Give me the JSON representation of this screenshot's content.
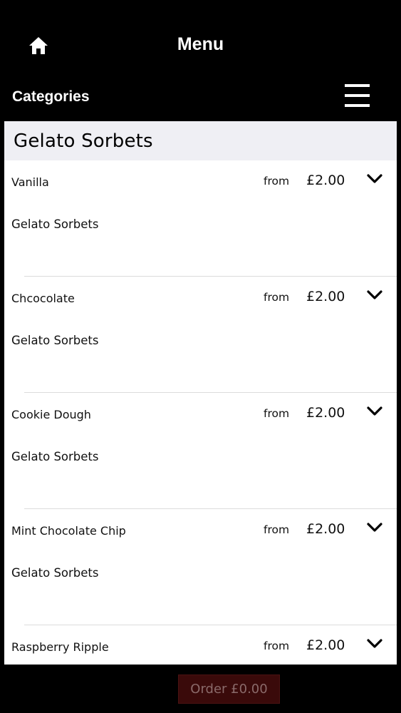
{
  "header": {
    "title": "Menu",
    "home_icon": "home-icon"
  },
  "categories_bar": {
    "label": "Categories",
    "menu_icon": "hamburger-menu-icon"
  },
  "section": {
    "title": "Gelato Sorbets"
  },
  "items": [
    {
      "name": "Vanilla",
      "from": "from",
      "price": "£2.00",
      "description": "Gelato Sorbets"
    },
    {
      "name": "Chcocolate",
      "from": "from",
      "price": "£2.00",
      "description": "Gelato Sorbets"
    },
    {
      "name": "Cookie Dough",
      "from": "from",
      "price": "£2.00",
      "description": "Gelato Sorbets"
    },
    {
      "name": "Mint Chocolate Chip",
      "from": "from",
      "price": "£2.00",
      "description": "Gelato Sorbets"
    },
    {
      "name": "Raspberry Ripple",
      "from": "from",
      "price": "£2.00",
      "description": ""
    }
  ],
  "footer": {
    "order_label": "Order £0.00"
  },
  "colors": {
    "background": "#000000",
    "section_header_bg": "#efeff4",
    "order_button_bg": "#3a0a0a"
  }
}
